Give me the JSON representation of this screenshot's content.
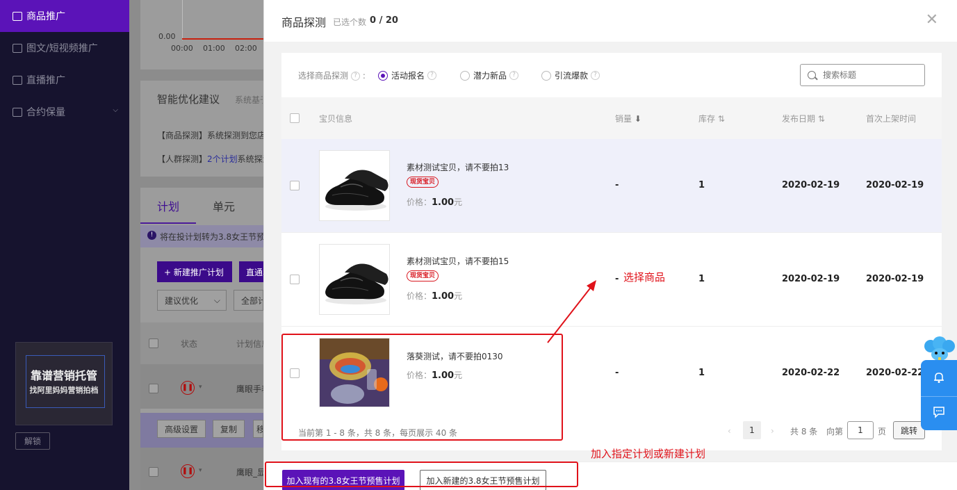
{
  "sidebar": {
    "items": [
      {
        "label": "商品推广",
        "active": true
      },
      {
        "label": "图文/短视频推广"
      },
      {
        "label": "直播推广"
      },
      {
        "label": "合约保量"
      }
    ],
    "promo": {
      "line1": "靠谱营销托管",
      "line2": "找阿里妈妈营销拍档"
    },
    "unlock_label": "解锁"
  },
  "background": {
    "chart": {
      "y_tick": "0.00",
      "x_ticks": [
        "00:00",
        "01:00",
        "02:00"
      ]
    },
    "advice": {
      "title": "智能优化建议",
      "subtitle": "系统基于",
      "line1": "【商品探测】系统探测到您店",
      "line2_prefix": "【人群探测】",
      "line2_link": "2个计划",
      "line2_suffix": "系统探测"
    },
    "tabs": [
      "计划",
      "单元"
    ],
    "notice": "将在投计划转为3.8女王节预售计划",
    "new_plan_button": "+ 新建推广计划",
    "direct_button": "直通车",
    "select_advice": "建议优化",
    "select_all": "全部计划",
    "col_status": "状态",
    "col_plan": "计划信息",
    "row1_name": "鹰眼手表",
    "row2_name": "鹰眼_显",
    "btn_advanced": "高级设置",
    "btn_copy": "复制",
    "btn_more": "移"
  },
  "drawer": {
    "title": "商品探测",
    "selected_label": "已选个数",
    "selected_count": "0 / 20",
    "filter": {
      "label": "选择商品探测",
      "options": [
        {
          "label": "活动报名",
          "selected": true
        },
        {
          "label": "潜力新品",
          "selected": false
        },
        {
          "label": "引流爆款",
          "selected": false
        }
      ],
      "search_placeholder": "搜索标题"
    },
    "columns": {
      "item": "宝贝信息",
      "sales": "销量",
      "stock": "库存",
      "publish_date": "发布日期",
      "first_listed": "首次上架时间"
    },
    "rows": [
      {
        "name": "素材测试宝贝，请不要拍13",
        "tag": "现货宝贝",
        "price_label": "价格：",
        "price": "1.00",
        "price_unit": "元",
        "sales": "-",
        "stock": "1",
        "publish_date": "2020-02-19",
        "first_listed": "2020-02-19"
      },
      {
        "name": "素材测试宝贝，请不要拍15",
        "tag": "现货宝贝",
        "price_label": "价格：",
        "price": "1.00",
        "price_unit": "元",
        "sales": "-",
        "stock": "1",
        "publish_date": "2020-02-19",
        "first_listed": "2020-02-19"
      },
      {
        "name": "落葵测试，请不要拍0130",
        "tag": "",
        "price_label": "价格：",
        "price": "1.00",
        "price_unit": "元",
        "sales": "-",
        "stock": "1",
        "publish_date": "2020-02-22",
        "first_listed": "2020-02-22"
      }
    ],
    "pagination": {
      "info": "当前第 1 - 8 条，共 8 条，每页展示 40 条",
      "current": "1",
      "total": "共 8 条",
      "goto_prefix": "向第",
      "goto_value": "1",
      "goto_suffix": "页",
      "jump_label": "跳转"
    },
    "actions": {
      "add_existing": "加入现有的3.8女王节预售计划",
      "add_new": "加入新建的3.8女王节预售计划"
    }
  },
  "annotations": {
    "select_goods": "选择商品",
    "add_plan": "加入指定计划或新建计划"
  },
  "colors": {
    "accent": "#5b13b8",
    "annotation": "#e0121a",
    "widget": "#2a8ef0"
  }
}
